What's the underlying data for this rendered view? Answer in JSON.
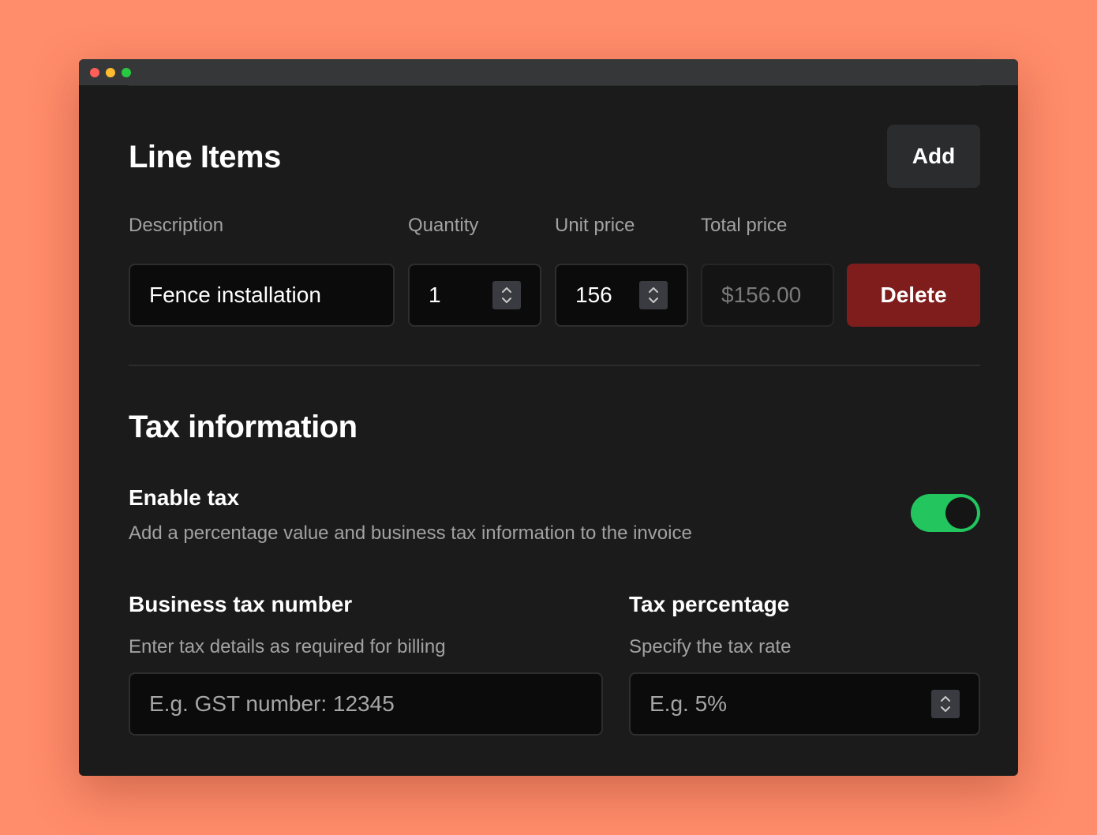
{
  "line_items": {
    "title": "Line Items",
    "add_label": "Add",
    "columns": {
      "description": "Description",
      "quantity": "Quantity",
      "unit_price": "Unit price",
      "total_price": "Total price"
    },
    "row": {
      "description": "Fence installation",
      "quantity": "1",
      "unit_price": "156",
      "total_price": "$156.00",
      "delete_label": "Delete"
    }
  },
  "tax": {
    "title": "Tax information",
    "enable_label": "Enable tax",
    "enable_description": "Add a percentage value and business tax information to the invoice",
    "enabled": true,
    "business_tax_number": {
      "label": "Business tax number",
      "description": "Enter tax details as required for billing",
      "placeholder": "E.g. GST number: 12345",
      "value": ""
    },
    "tax_percentage": {
      "label": "Tax percentage",
      "description": "Specify the tax rate",
      "placeholder": "E.g. 5%",
      "value": ""
    }
  },
  "colors": {
    "page_background": "#ff8c6b",
    "window_background": "#1b1b1b",
    "delete_button": "#7f1d1d",
    "toggle_on": "#22c55e"
  },
  "icons": {
    "stepper": "chevron-up-down-icon"
  }
}
